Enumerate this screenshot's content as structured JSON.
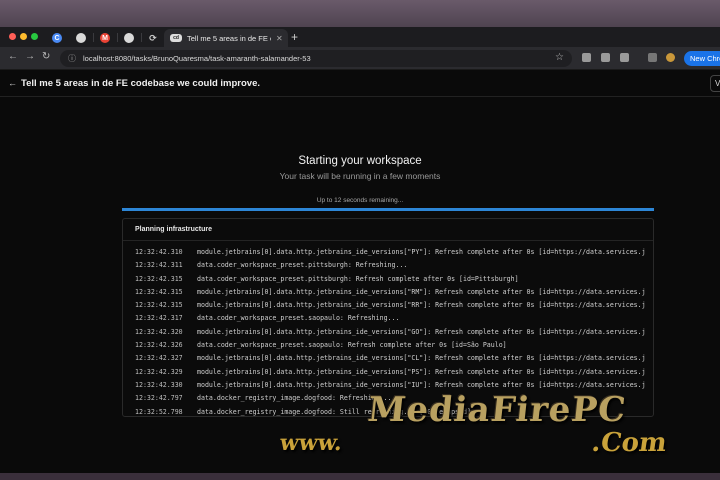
{
  "browser": {
    "tabs": [
      {
        "icon": "chrome-icon",
        "letter": "C"
      },
      {
        "icon": "github-icon",
        "letter": ""
      },
      {
        "icon": "gmail-icon",
        "letter": "M"
      },
      {
        "icon": "github-icon",
        "letter": ""
      },
      {
        "icon": "refresh-icon",
        "letter": ""
      }
    ],
    "active_tab": {
      "title": "Tell me 5 areas in de FE codebase we could improve.",
      "favicon_label": "cd"
    },
    "url": "localhost:8080/tasks/BrunoQuaresma/task-amaranth-salamander-53",
    "new_chrome_label": "New Chro",
    "colors": {
      "accent": "#1a73e8"
    }
  },
  "page": {
    "task_title": "Tell me 5 areas in de FE codebase we could improve.",
    "header_right_label": "V",
    "heading": "Starting your workspace",
    "subheading": "Your task will be running in a few moments",
    "remaining": "Up to 12 seconds remaining...",
    "progress_fraction": 1.0,
    "progress_color": "#2d86d6"
  },
  "log": {
    "title": "Planning infrastructure",
    "lines": [
      {
        "time": "12:32:42.310",
        "msg": "module.jetbrains[0].data.http.jetbrains_ide_versions[\"PY\"]: Refresh complete after 0s [id=https://data.services.j"
      },
      {
        "time": "12:32:42.311",
        "msg": "data.coder_workspace_preset.pittsburgh: Refreshing..."
      },
      {
        "time": "12:32:42.315",
        "msg": "data.coder_workspace_preset.pittsburgh: Refresh complete after 0s [id=Pittsburgh]"
      },
      {
        "time": "12:32:42.315",
        "msg": "module.jetbrains[0].data.http.jetbrains_ide_versions[\"RM\"]: Refresh complete after 0s [id=https://data.services.j"
      },
      {
        "time": "12:32:42.315",
        "msg": "module.jetbrains[0].data.http.jetbrains_ide_versions[\"RR\"]: Refresh complete after 0s [id=https://data.services.j"
      },
      {
        "time": "12:32:42.317",
        "msg": "data.coder_workspace_preset.saopaulo: Refreshing..."
      },
      {
        "time": "12:32:42.320",
        "msg": "module.jetbrains[0].data.http.jetbrains_ide_versions[\"GO\"]: Refresh complete after 0s [id=https://data.services.j"
      },
      {
        "time": "12:32:42.326",
        "msg": "data.coder_workspace_preset.saopaulo: Refresh complete after 0s [id=São Paulo]"
      },
      {
        "time": "12:32:42.327",
        "msg": "module.jetbrains[0].data.http.jetbrains_ide_versions[\"CL\"]: Refresh complete after 0s [id=https://data.services.j"
      },
      {
        "time": "12:32:42.329",
        "msg": "module.jetbrains[0].data.http.jetbrains_ide_versions[\"PS\"]: Refresh complete after 0s [id=https://data.services.j"
      },
      {
        "time": "12:32:42.330",
        "msg": "module.jetbrains[0].data.http.jetbrains_ide_versions[\"IU\"]: Refresh complete after 0s [id=https://data.services.j"
      },
      {
        "time": "12:32:42.797",
        "msg": "data.docker_registry_image.dogfood: Refreshing..."
      },
      {
        "time": "12:32:52.798",
        "msg": "data.docker_registry_image.dogfood: Still refreshing... [10s elapsed]"
      }
    ]
  },
  "watermark": {
    "main": "MediaFirePC",
    "prefix": "www.",
    "suffix": ".Com"
  }
}
